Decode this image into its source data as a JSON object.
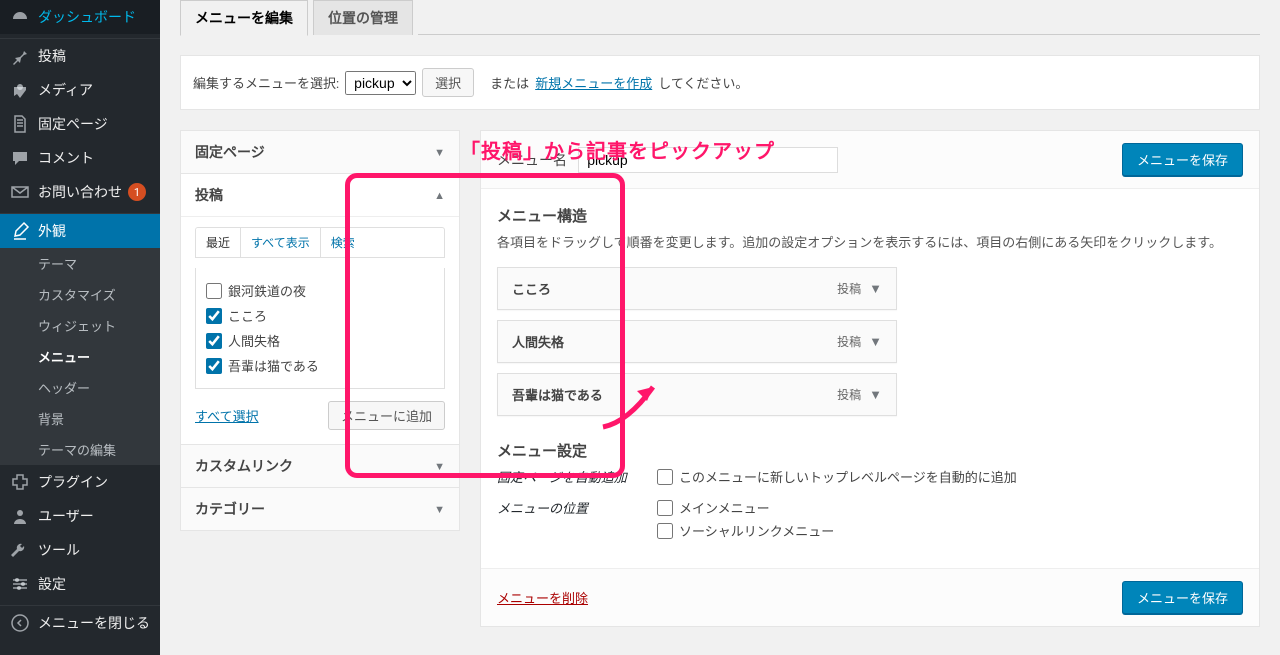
{
  "sidebar": {
    "items": [
      {
        "icon": "dashboard",
        "label": "ダッシュボード"
      },
      {
        "icon": "pin",
        "label": "投稿"
      },
      {
        "icon": "media",
        "label": "メディア"
      },
      {
        "icon": "page",
        "label": "固定ページ"
      },
      {
        "icon": "comment",
        "label": "コメント"
      },
      {
        "icon": "envelope",
        "label": "お問い合わせ",
        "badge": "1"
      },
      {
        "icon": "brush",
        "label": "外観",
        "current": true,
        "submenu": [
          {
            "label": "テーマ"
          },
          {
            "label": "カスタマイズ"
          },
          {
            "label": "ウィジェット"
          },
          {
            "label": "メニュー",
            "current": true
          },
          {
            "label": "ヘッダー"
          },
          {
            "label": "背景"
          },
          {
            "label": "テーマの編集"
          }
        ]
      },
      {
        "icon": "plugin",
        "label": "プラグイン"
      },
      {
        "icon": "user",
        "label": "ユーザー"
      },
      {
        "icon": "wrench",
        "label": "ツール"
      },
      {
        "icon": "sliders",
        "label": "設定"
      },
      {
        "icon": "collapse",
        "label": "メニューを閉じる"
      }
    ]
  },
  "tabs": {
    "edit": "メニューを編集",
    "locations": "位置の管理"
  },
  "selector_bar": {
    "label": "編集するメニューを選択:",
    "selected": "pickup",
    "choose_btn": "選択",
    "or_text": "または",
    "create_link": "新規メニューを作成",
    "suffix": "してください。"
  },
  "annotation": "「投稿」から記事をピックアップ",
  "accordions": {
    "pages": "固定ページ",
    "posts": "投稿",
    "custom": "カスタムリンク",
    "categories": "カテゴリー"
  },
  "post_subtabs": {
    "recent": "最近",
    "all": "すべて表示",
    "search": "検索"
  },
  "post_items": [
    {
      "label": "銀河鉄道の夜",
      "checked": false
    },
    {
      "label": "こころ",
      "checked": true
    },
    {
      "label": "人間失格",
      "checked": true
    },
    {
      "label": "吾輩は猫である",
      "checked": true
    }
  ],
  "select_all": "すべて選択",
  "add_to_menu": "メニューに追加",
  "menu_name_label": "メニュー名",
  "menu_name_value": "pickup",
  "save_btn": "メニューを保存",
  "structure_title": "メニュー構造",
  "structure_desc": "各項目をドラッグして順番を変更します。追加の設定オプションを表示するには、項目の右側にある矢印をクリックします。",
  "menu_items": [
    {
      "title": "こころ",
      "type": "投稿"
    },
    {
      "title": "人間失格",
      "type": "投稿"
    },
    {
      "title": "吾輩は猫である",
      "type": "投稿"
    }
  ],
  "settings_title": "メニュー設定",
  "setting_auto_label": "固定ページを自動追加",
  "setting_auto_opt": "このメニューに新しいトップレベルページを自動的に追加",
  "setting_loc_label": "メニューの位置",
  "setting_loc_opts": [
    "メインメニュー",
    "ソーシャルリンクメニュー"
  ],
  "delete_menu": "メニューを削除"
}
